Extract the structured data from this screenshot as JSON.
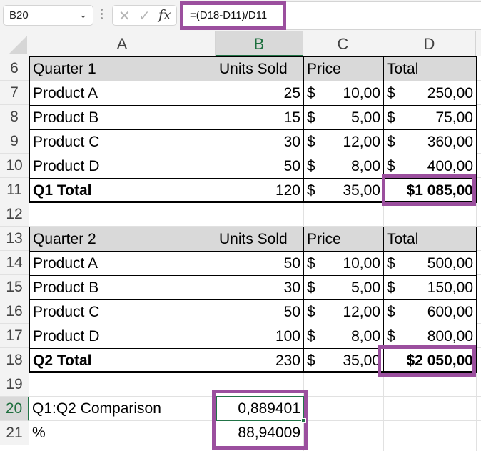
{
  "formula_bar": {
    "name_box": "B20",
    "cancel_icon": "✕",
    "enter_icon": "✓",
    "fx_label": "fx",
    "formula": "=(D18-D11)/D11"
  },
  "columns": [
    "A",
    "B",
    "C",
    "D"
  ],
  "selected_column": "B",
  "selected_row": "20",
  "rows": [
    {
      "num": "6",
      "type": "header",
      "cells": [
        "Quarter 1",
        "Units Sold",
        "Price",
        "Total"
      ]
    },
    {
      "num": "7",
      "type": "data",
      "cells": [
        "Product A",
        "25",
        "10,00",
        "250,00"
      ]
    },
    {
      "num": "8",
      "type": "data",
      "cells": [
        "Product B",
        "15",
        "5,00",
        "75,00"
      ]
    },
    {
      "num": "9",
      "type": "data",
      "cells": [
        "Product C",
        "30",
        "12,00",
        "360,00"
      ]
    },
    {
      "num": "10",
      "type": "data",
      "cells": [
        "Product D",
        "50",
        "8,00",
        "400,00"
      ]
    },
    {
      "num": "11",
      "type": "total",
      "cells": [
        "Q1 Total",
        "120",
        "35,00",
        "$1 085,00"
      ]
    },
    {
      "num": "12",
      "type": "empty",
      "cells": [
        "",
        "",
        "",
        ""
      ]
    },
    {
      "num": "13",
      "type": "header",
      "cells": [
        "Quarter 2",
        "Units Sold",
        "Price",
        "Total"
      ]
    },
    {
      "num": "14",
      "type": "data",
      "cells": [
        "Product A",
        "50",
        "10,00",
        "500,00"
      ]
    },
    {
      "num": "15",
      "type": "data",
      "cells": [
        "Product B",
        "30",
        "5,00",
        "150,00"
      ]
    },
    {
      "num": "16",
      "type": "data",
      "cells": [
        "Product C",
        "50",
        "12,00",
        "600,00"
      ]
    },
    {
      "num": "17",
      "type": "data",
      "cells": [
        "Product D",
        "100",
        "8,00",
        "800,00"
      ]
    },
    {
      "num": "18",
      "type": "total",
      "cells": [
        "Q2 Total",
        "230",
        "35,00",
        "$2 050,00"
      ]
    },
    {
      "num": "19",
      "type": "empty",
      "cells": [
        "",
        "",
        "",
        ""
      ]
    },
    {
      "num": "20",
      "type": "plain",
      "cells": [
        "Q1:Q2 Comparison",
        "0,889401",
        "",
        ""
      ]
    },
    {
      "num": "21",
      "type": "plain",
      "cells": [
        "%",
        "88,94009",
        "",
        ""
      ]
    }
  ],
  "currency_symbol": "$",
  "highlight_color": "#9b4f9e",
  "selection_color": "#217346"
}
